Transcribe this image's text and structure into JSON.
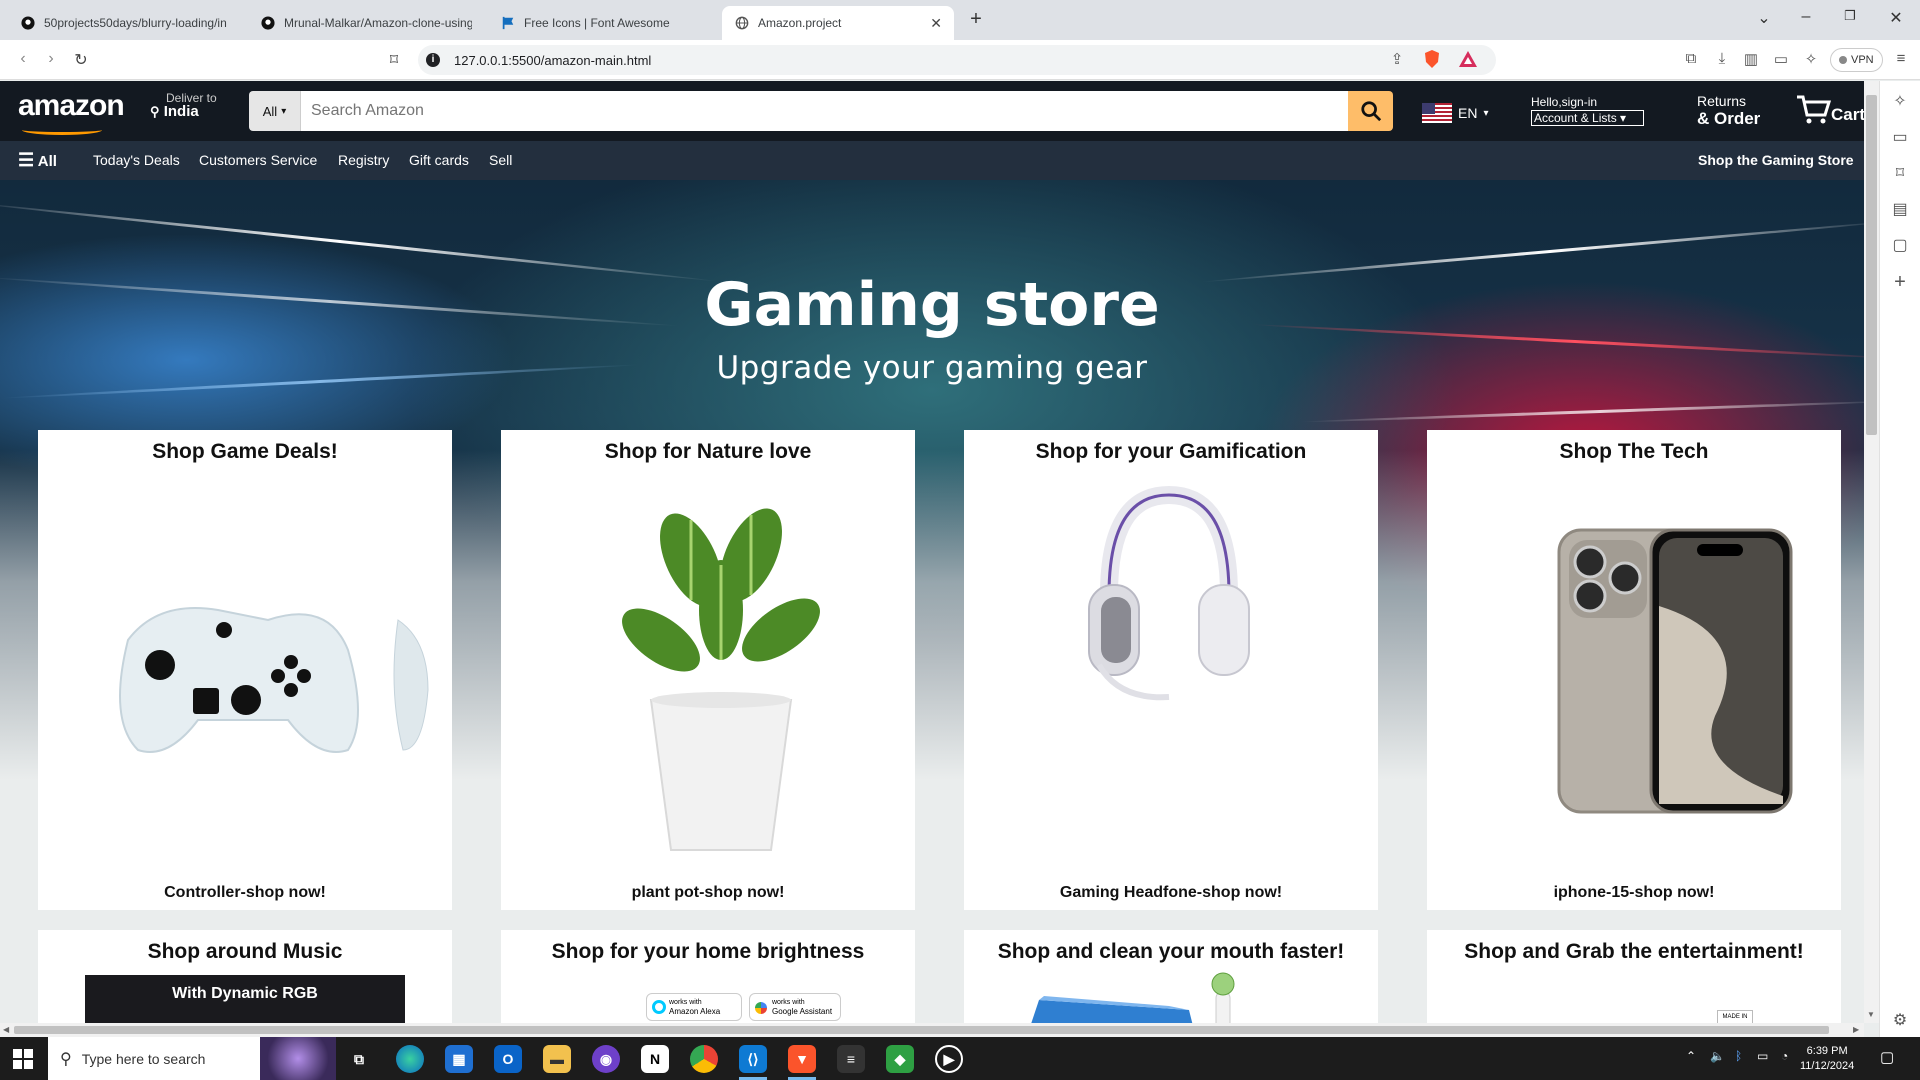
{
  "browser": {
    "tabs": [
      {
        "title": "50projects50days/blurry-loading/in",
        "icon": "github-icon",
        "active": false
      },
      {
        "title": "Mrunal-Malkar/Amazon-clone-using",
        "icon": "github-icon",
        "active": false
      },
      {
        "title": "Free Icons | Font Awesome",
        "icon": "font-awesome-flag-icon",
        "active": false
      },
      {
        "title": "Amazon.project",
        "icon": "globe-icon",
        "active": true
      }
    ],
    "new_tab": "+",
    "url": "127.0.0.1:5500/amazon-main.html",
    "vpn_label": "VPN"
  },
  "header": {
    "logo": "amazon",
    "deliver_label": "Deliver to",
    "deliver_location": "India",
    "search_category": "All",
    "search_placeholder": "Search Amazon",
    "language": "EN",
    "account_greeting": "Hello,sign-in",
    "account_select": "Account & Lists",
    "returns_line1": "Returns",
    "returns_line2": "& Order",
    "cart_label": "Cart"
  },
  "subnav": {
    "all_label": "All",
    "items": [
      "Today's Deals",
      "Customers Service",
      "Registry",
      "Gift cards",
      "Sell"
    ],
    "right_link": "Shop the Gaming Store"
  },
  "hero": {
    "title": "Gaming store",
    "subtitle": "Upgrade your gaming gear"
  },
  "cards": [
    {
      "title": "Shop Game Deals!",
      "footer": "Controller-shop now!",
      "image": "game-controller"
    },
    {
      "title": "Shop for Nature love",
      "footer": "plant pot-shop now!",
      "image": "potted-plant"
    },
    {
      "title": "Shop for your Gamification",
      "footer": "Gaming Headfone-shop now!",
      "image": "gaming-headset"
    },
    {
      "title": "Shop The Tech",
      "footer": "iphone-15-shop now!",
      "image": "iphone-15"
    },
    {
      "title": "Shop around Music",
      "footer": "",
      "image": "rgb-leds-banner",
      "banner_text": "With Dynamic RGB"
    },
    {
      "title": "Shop for your home brightness",
      "footer": "",
      "image": "smart-bulb",
      "badges": [
        "Amazon Alexa",
        "Google Assistant"
      ],
      "badge_prefix": "works with"
    },
    {
      "title": "Shop and clean your mouth faster!",
      "footer": "",
      "image": "electric-toothbrush"
    },
    {
      "title": "Shop and Grab the entertainment!",
      "footer": "",
      "image": "entertainment-box",
      "badges": [
        "MADE IN"
      ]
    }
  ],
  "taskbar": {
    "search_placeholder": "Type here to search",
    "time": "6:39 PM",
    "date": "11/12/2024"
  },
  "colors": {
    "nav_bg": "#131921",
    "subnav_bg": "#232f3e",
    "search_btn": "#febd69",
    "accent": "#ff9900"
  }
}
